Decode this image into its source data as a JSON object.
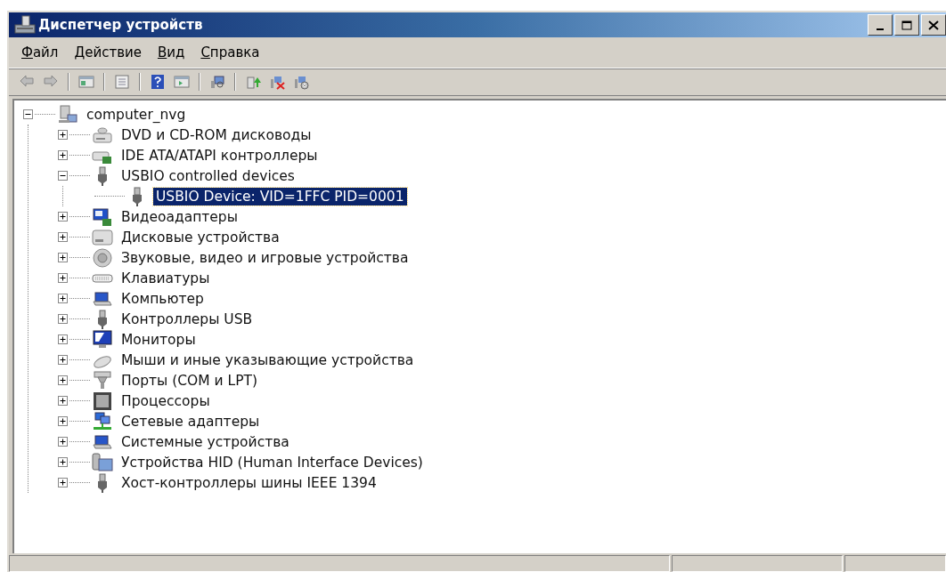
{
  "window": {
    "title": "Диспетчер устройств"
  },
  "menu": [
    {
      "label": "Файл"
    },
    {
      "label": "Действие"
    },
    {
      "label": "Вид"
    },
    {
      "label": "Справка"
    }
  ],
  "tree": [
    {
      "label": "computer_nvg",
      "kind": "computer",
      "expanded": true,
      "selected": false,
      "children": [
        {
          "label": "DVD и CD-ROM дисководы",
          "kind": "optical",
          "expanded": false,
          "selected": false
        },
        {
          "label": "IDE ATA/ATAPI контроллеры",
          "kind": "controller",
          "expanded": false,
          "selected": false
        },
        {
          "label": "USBIO controlled devices",
          "kind": "usb",
          "expanded": true,
          "selected": false,
          "children": [
            {
              "label": "USBIO Device: VID=1FFC PID=0001",
              "kind": "usb",
              "selected": true
            }
          ]
        },
        {
          "label": "Видеоадаптеры",
          "kind": "display",
          "expanded": false,
          "selected": false
        },
        {
          "label": "Дисковые устройства",
          "kind": "disk",
          "expanded": false,
          "selected": false
        },
        {
          "label": "Звуковые, видео и игровые устройства",
          "kind": "sound",
          "expanded": false,
          "selected": false
        },
        {
          "label": "Клавиатуры",
          "kind": "keyboard",
          "expanded": false,
          "selected": false
        },
        {
          "label": "Компьютер",
          "kind": "system",
          "expanded": false,
          "selected": false
        },
        {
          "label": "Контроллеры USB",
          "kind": "usb",
          "expanded": false,
          "selected": false
        },
        {
          "label": "Мониторы",
          "kind": "monitor",
          "expanded": false,
          "selected": false
        },
        {
          "label": "Мыши и иные указывающие устройства",
          "kind": "mouse",
          "expanded": false,
          "selected": false
        },
        {
          "label": "Порты (COM и LPT)",
          "kind": "port",
          "expanded": false,
          "selected": false
        },
        {
          "label": "Процессоры",
          "kind": "cpu",
          "expanded": false,
          "selected": false
        },
        {
          "label": "Сетевые адаптеры",
          "kind": "network",
          "expanded": false,
          "selected": false
        },
        {
          "label": "Системные устройства",
          "kind": "system",
          "expanded": false,
          "selected": false
        },
        {
          "label": "Устройства HID (Human Interface Devices)",
          "kind": "hid",
          "expanded": false,
          "selected": false
        },
        {
          "label": "Хост-контроллеры шины IEEE 1394",
          "kind": "usb",
          "expanded": false,
          "selected": false
        }
      ]
    }
  ]
}
